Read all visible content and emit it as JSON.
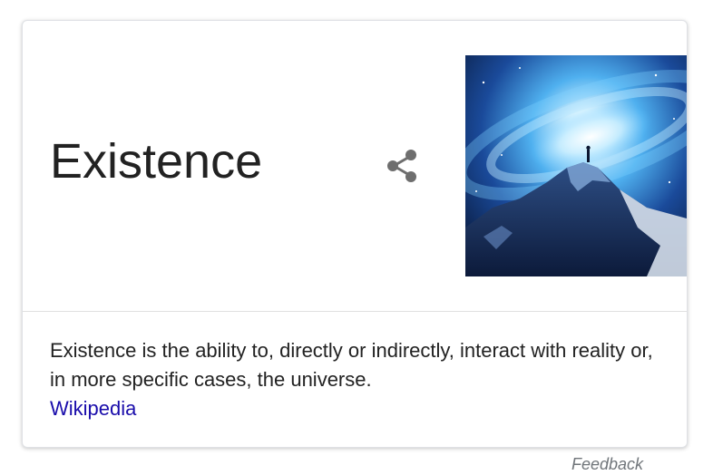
{
  "knowledge_panel": {
    "title": "Existence",
    "share_icon": "share-icon",
    "image_alt": "Galaxy over a mountain peak with a lone figure",
    "description": "Existence is the ability to, directly or indirectly, interact with reality or, in more specific cases, the universe.",
    "source_link": "Wikipedia",
    "link_color": "#1a0dab",
    "text_color": "#222222"
  },
  "footer": {
    "feedback_label": "Feedback"
  }
}
